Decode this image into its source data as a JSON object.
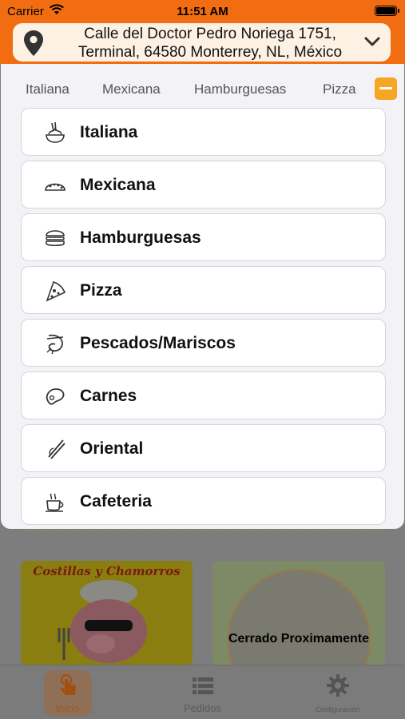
{
  "status": {
    "carrier": "Carrier",
    "time": "11:51 AM"
  },
  "address": {
    "text": "Calle del Doctor Pedro Noriega 1751, Terminal, 64580 Monterrey, NL, México"
  },
  "chips": [
    "Italiana",
    "Mexicana",
    "Hamburguesas",
    "Pizza"
  ],
  "categories": [
    {
      "label": "Italiana",
      "icon": "spaghetti-icon"
    },
    {
      "label": "Mexicana",
      "icon": "taco-icon"
    },
    {
      "label": "Hamburguesas",
      "icon": "burger-icon"
    },
    {
      "label": "Pizza",
      "icon": "pizza-slice-icon"
    },
    {
      "label": "Pescados/Mariscos",
      "icon": "shrimp-icon"
    },
    {
      "label": "Carnes",
      "icon": "steak-icon"
    },
    {
      "label": "Oriental",
      "icon": "chopsticks-icon"
    },
    {
      "label": "Cafeteria",
      "icon": "coffee-cup-icon"
    }
  ],
  "restaurants": [
    {
      "name": "Costillas y Chamorros"
    },
    {
      "name": "",
      "status": "Cerrado Proximamente"
    }
  ],
  "tabs": [
    {
      "label": "Inicio",
      "icon": "touch-hand-icon"
    },
    {
      "label": "Pedidos",
      "icon": "list-icon"
    },
    {
      "label": "Configuración",
      "icon": "gear-icon"
    }
  ],
  "colors": {
    "header": "#f26d12",
    "accent": "#f5a623",
    "panel": "#f2f2f7"
  }
}
